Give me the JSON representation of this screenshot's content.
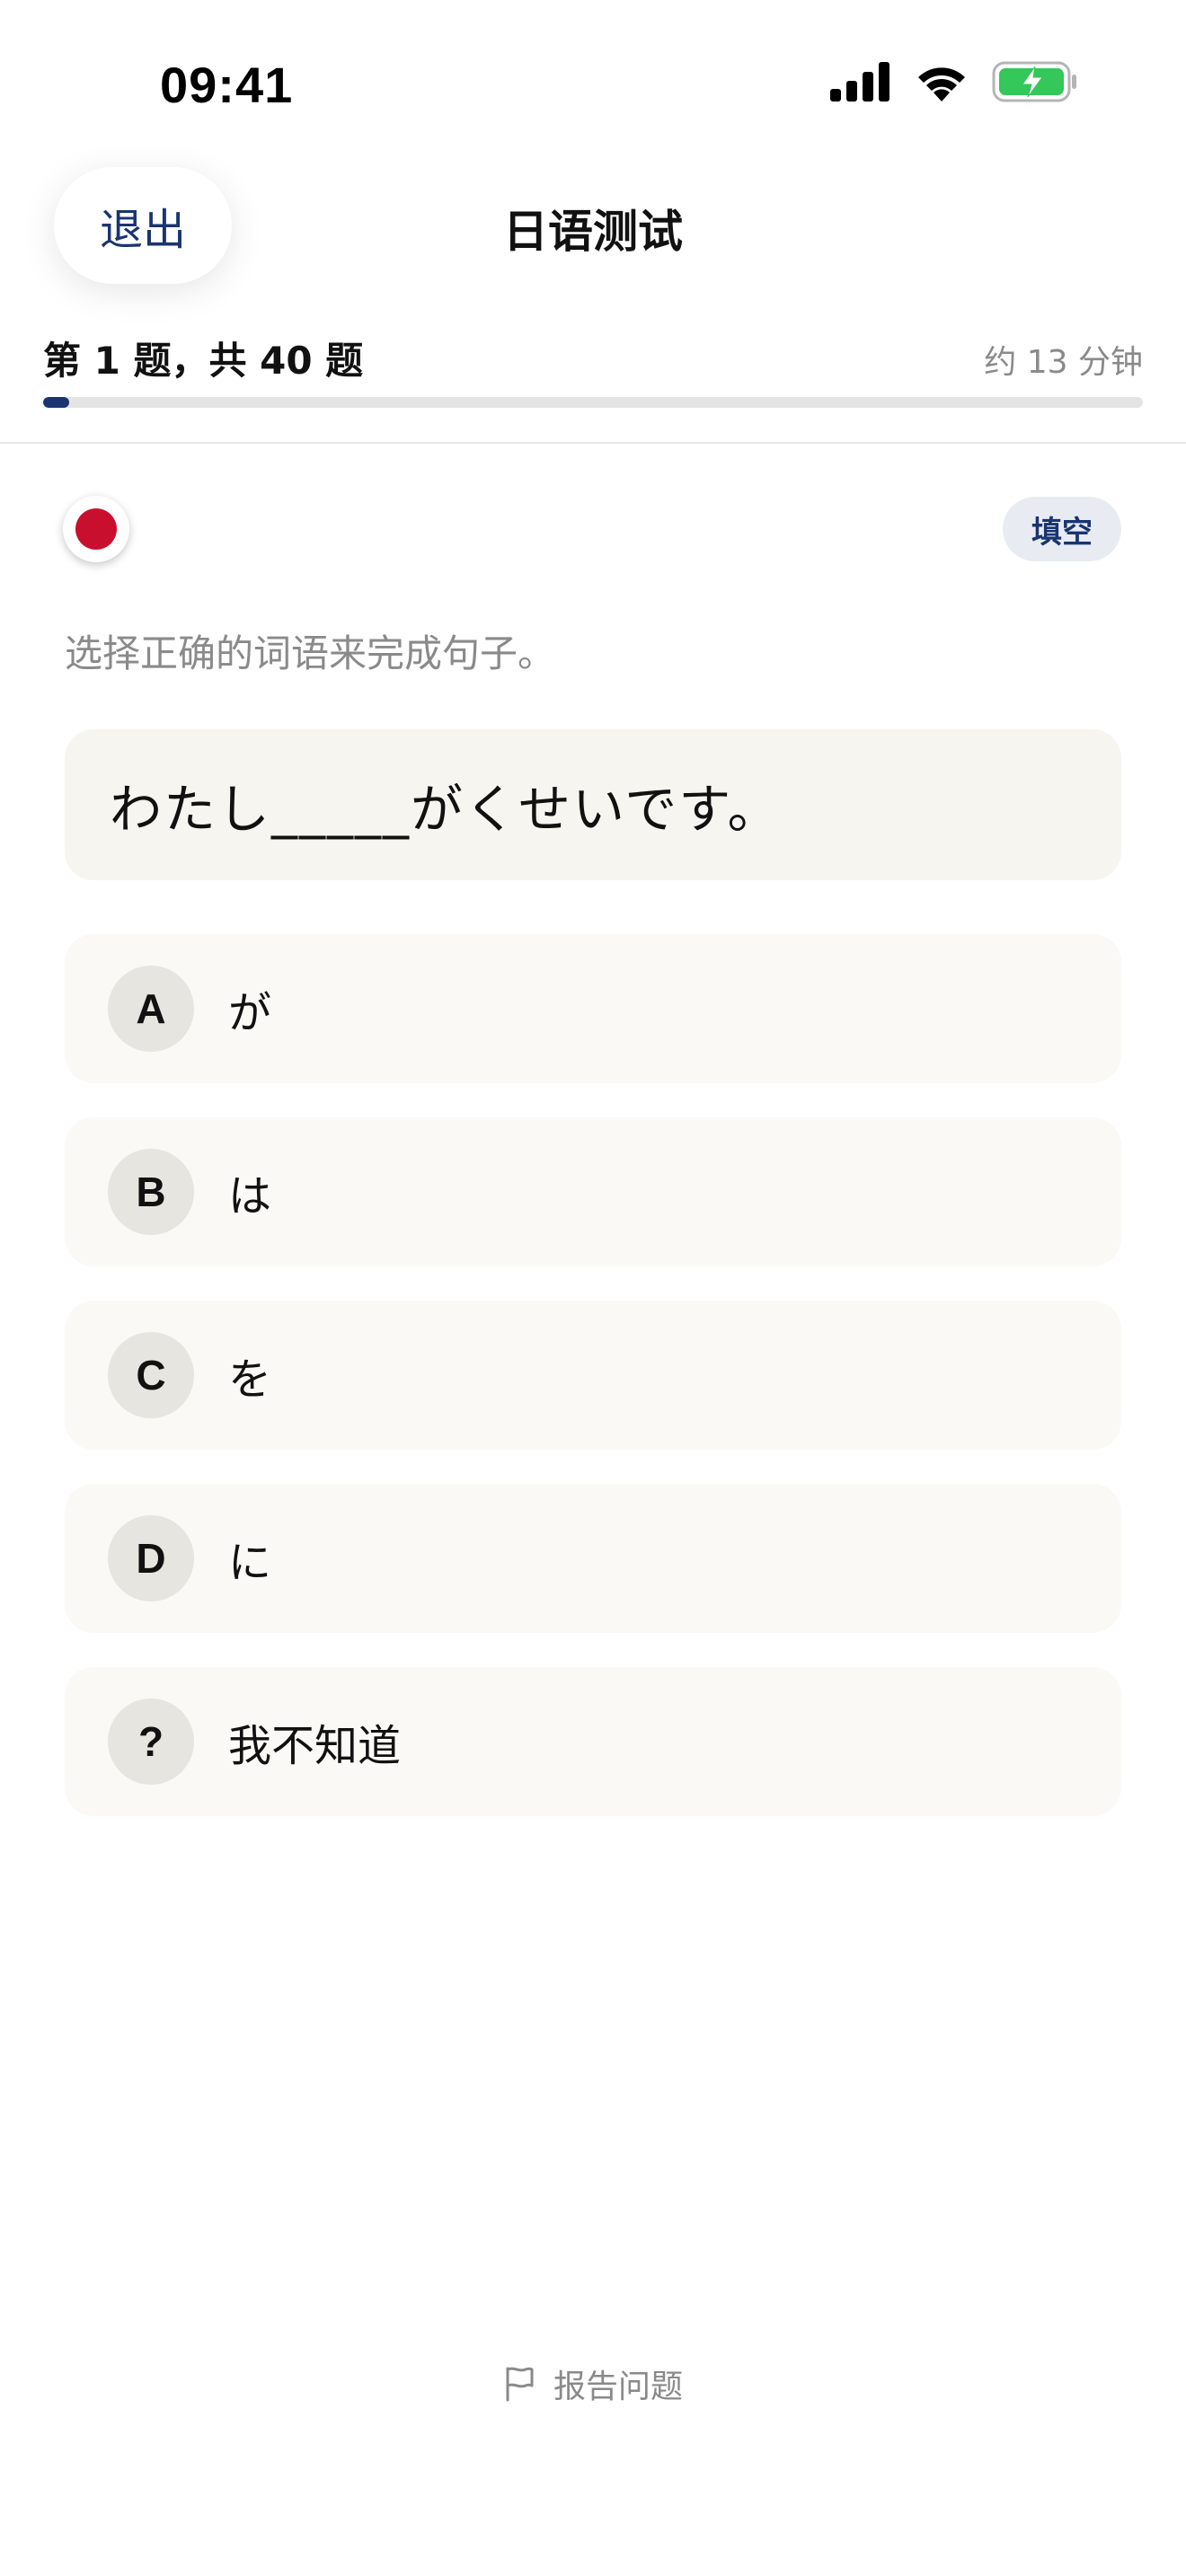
{
  "status_bar": {
    "time": "09:41"
  },
  "header": {
    "exit_label": "退出",
    "title": "日语测试"
  },
  "progress": {
    "label": "第 1 题，共 40 题",
    "time_estimate": "约 13 分钟",
    "current": 1,
    "total": 40
  },
  "question": {
    "language_flag": "japan-flag-icon",
    "type_chip": "填空",
    "instruction": "选择正确的词语来完成句子。",
    "sentence": "わたし_____がくせいです。"
  },
  "options": [
    {
      "letter": "A",
      "text": "が"
    },
    {
      "letter": "B",
      "text": "は"
    },
    {
      "letter": "C",
      "text": "を"
    },
    {
      "letter": "D",
      "text": "に"
    },
    {
      "letter": "?",
      "text": "我不知道"
    }
  ],
  "footer": {
    "report_label": "报告问题"
  },
  "colors": {
    "accent": "#1a3470",
    "flag_red": "#c8102e",
    "battery_green": "#34c759"
  }
}
